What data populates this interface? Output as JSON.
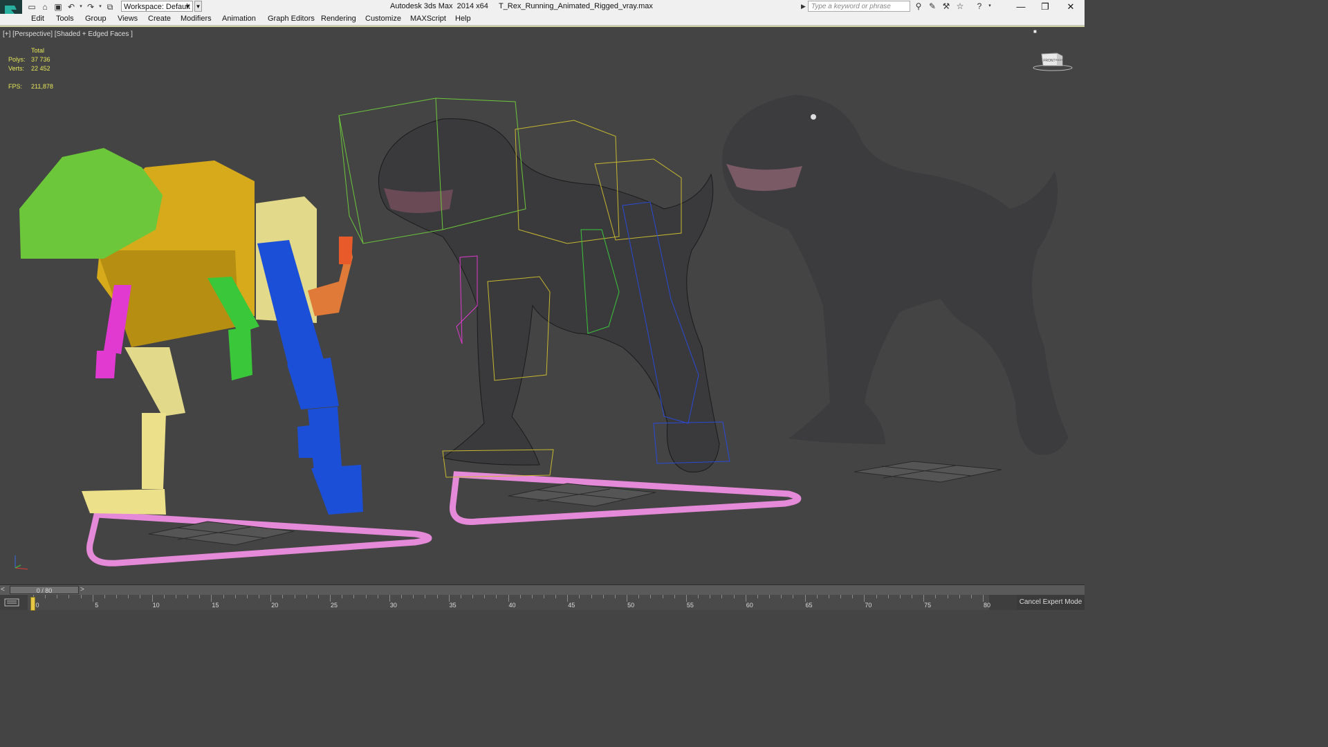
{
  "titlebar": {
    "workspace_label": "Workspace: Default",
    "app_title": "Autodesk 3ds Max  2014 x64     T_Rex_Running_Animated_Rigged_vray.max",
    "search_placeholder": "Type a keyword or phrase"
  },
  "menu": [
    "Edit",
    "Tools",
    "Group",
    "Views",
    "Create",
    "Modifiers",
    "Animation",
    "Graph Editors",
    "Rendering",
    "Customize",
    "MAXScript",
    "Help"
  ],
  "viewport": {
    "label": "[+] [Perspective] [Shaded + Edged Faces ]",
    "stats": {
      "header": "Total",
      "polys_label": "Polys:",
      "polys_value": "37 736",
      "verts_label": "Verts:",
      "verts_value": "22 452",
      "fps_label": "FPS:",
      "fps_value": "211,878"
    },
    "viewcube": {
      "front": "FRONT",
      "side": "RIGHT"
    }
  },
  "timeslider": {
    "value": "0 / 80",
    "current_frame": 0,
    "total_frames": 80
  },
  "track": {
    "ticks": [
      "0",
      "5",
      "10",
      "15",
      "20",
      "25",
      "30",
      "35",
      "40",
      "45",
      "50",
      "55",
      "60",
      "65",
      "70",
      "75",
      "80"
    ]
  },
  "status": {
    "expert_mode_label": "Cancel Expert Mode"
  },
  "colors": {
    "viewport_bg": "#444444",
    "stats_text": "#e6e65a",
    "path": "#e58ad8",
    "rig_green": "#6cc83a",
    "rig_yellow": "#d6aa1a",
    "rig_blue": "#1c4fd8",
    "rig_magenta": "#e03ad0",
    "rig_orange": "#e07a38",
    "rig_pale": "#ece08a"
  }
}
